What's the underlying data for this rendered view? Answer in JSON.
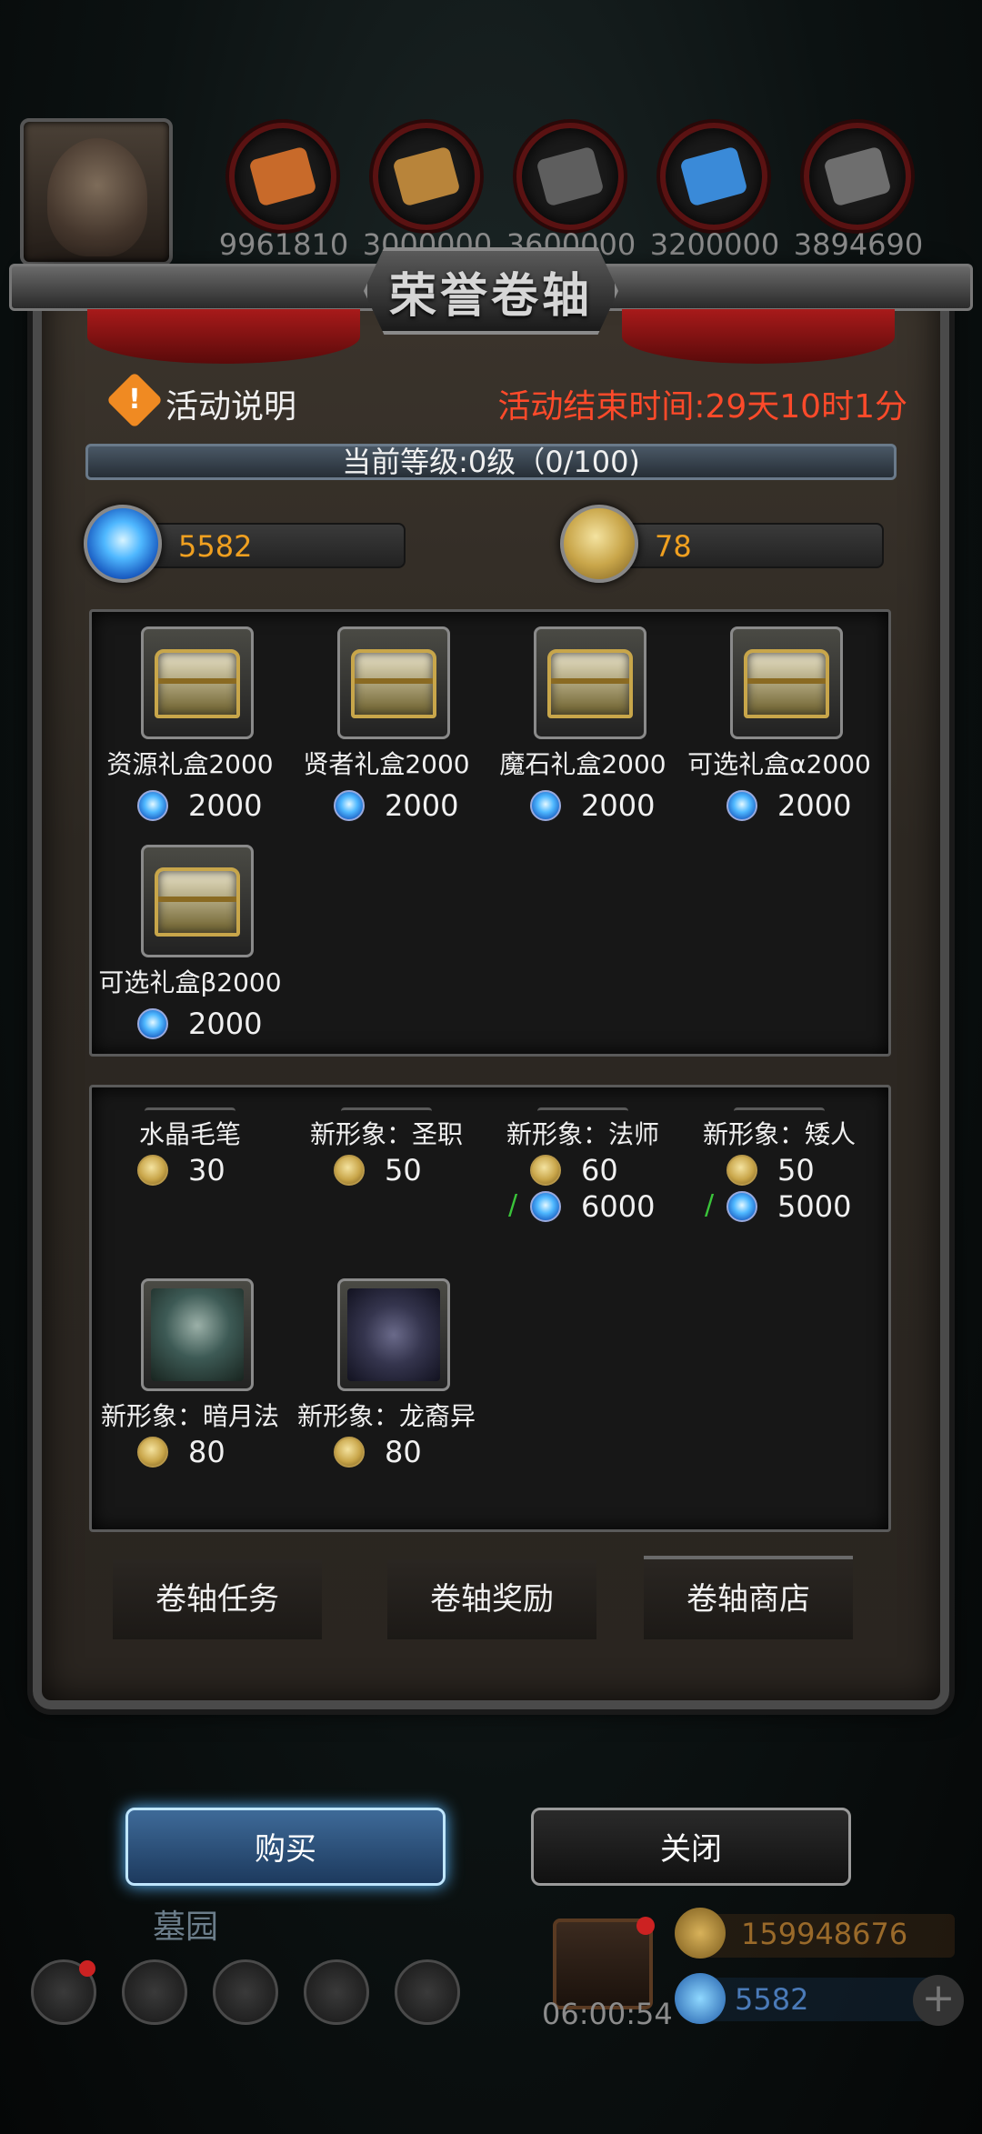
{
  "top_resources": [
    {
      "name": "wood-icon",
      "count": "9961810",
      "color": "#c86a2a"
    },
    {
      "name": "plank-icon",
      "count": "3000000",
      "color": "#b8843a"
    },
    {
      "name": "stone-icon",
      "count": "3600000",
      "color": "#6a6a6a"
    },
    {
      "name": "crystal-icon",
      "count": "3200000",
      "color": "#3a8ad8"
    },
    {
      "name": "iron-icon",
      "count": "3894690",
      "color": "#6e6e6e"
    }
  ],
  "panel": {
    "title": "荣誉卷轴",
    "info_label": "活动说明",
    "end_time": "活动结束时间:29天10时1分",
    "level": "当前等级:0级（0/100)",
    "gems": "5582",
    "coins": "78"
  },
  "gift_boxes": [
    {
      "name": "资源礼盒2000",
      "price": "2000"
    },
    {
      "name": "贤者礼盒2000",
      "price": "2000"
    },
    {
      "name": "魔石礼盒2000",
      "price": "2000"
    },
    {
      "name": "可选礼盒α2000",
      "price": "2000"
    },
    {
      "name": "可选礼盒β2000",
      "price": "2000"
    }
  ],
  "scroll_shop": [
    {
      "name": "水晶毛笔",
      "coin_price": "30"
    },
    {
      "name": "新形象：圣职",
      "coin_price": "50"
    },
    {
      "name": "新形象：法师",
      "coin_price": "60",
      "alt_sep": "/",
      "gem_price": "6000"
    },
    {
      "name": "新形象：矮人",
      "coin_price": "50",
      "alt_sep": "/",
      "gem_price": "5000"
    },
    {
      "name": "新形象：暗月法",
      "coin_price": "80"
    },
    {
      "name": "新形象：龙裔异",
      "coin_price": "80"
    }
  ],
  "tabs": [
    "卷轴任务",
    "卷轴奖励",
    "卷轴商店"
  ],
  "active_tab": "卷轴商店",
  "buttons": {
    "buy": "购买",
    "close": "关闭"
  },
  "hud": {
    "location": "墓园",
    "timer": "06:00:54",
    "gold": "159948676",
    "gems": "5582",
    "plus": "+"
  },
  "colors": {
    "accent_red": "#ff4a2a",
    "currency_orange": "#f0a020",
    "buy_glow": "#5ab8ff"
  }
}
